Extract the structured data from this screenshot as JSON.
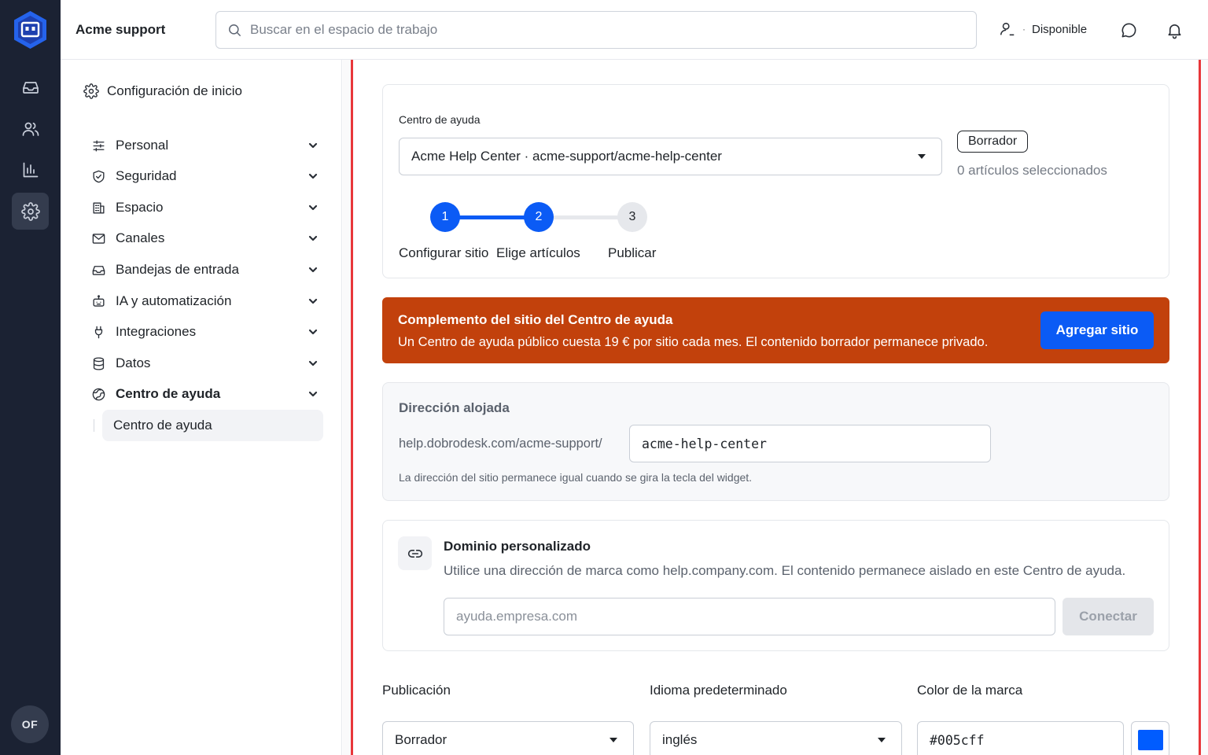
{
  "app": {
    "workspace_name": "Acme support"
  },
  "search": {
    "placeholder": "Buscar en el espacio de trabajo"
  },
  "status": {
    "label": "Disponible"
  },
  "user": {
    "initials": "OF"
  },
  "rail": {
    "items": [
      "inbox-icon",
      "users-icon",
      "chart-icon",
      "gear-icon"
    ],
    "active": "gear-icon"
  },
  "sidebar": {
    "title": "Configuración de inicio",
    "items": [
      {
        "label": "Personal",
        "icon": "sliders-icon"
      },
      {
        "label": "Seguridad",
        "icon": "shield-icon"
      },
      {
        "label": "Espacio",
        "icon": "building-icon"
      },
      {
        "label": "Canales",
        "icon": "mail-icon"
      },
      {
        "label": "Bandejas de entrada",
        "icon": "inbox-icon"
      },
      {
        "label": "IA y automatización",
        "icon": "robot-icon"
      },
      {
        "label": "Integraciones",
        "icon": "plug-icon"
      },
      {
        "label": "Datos",
        "icon": "database-icon"
      },
      {
        "label": "Centro de ayuda",
        "icon": "globe-icon",
        "expanded": true
      }
    ],
    "sub_item": "Centro de ayuda"
  },
  "help_center": {
    "label": "Centro de ayuda",
    "selected": "Acme Help Center · acme-support/acme-help-center",
    "badge": "Borrador",
    "articles_count": "0 artículos seleccionados",
    "steps": [
      {
        "number": "1",
        "label": "Configurar sitio",
        "state": "done"
      },
      {
        "number": "2",
        "label": "Elige artículos",
        "state": "done"
      },
      {
        "number": "3",
        "label": "Publicar",
        "state": "todo"
      }
    ]
  },
  "banner": {
    "title": "Complemento del sitio del Centro de ayuda",
    "text": "Un Centro de ayuda público cuesta 19 € por sitio cada mes. El contenido borrador permanece privado.",
    "button": "Agregar sitio",
    "color": "#c2410c"
  },
  "hosted": {
    "title": "Dirección alojada",
    "prefix": "help.dobrodesk.com/acme-support/",
    "slug": "acme-help-center",
    "hint": "La dirección del sitio permanece igual cuando se gira la tecla del widget."
  },
  "custom_domain": {
    "title": "Dominio personalizado",
    "description": "Utilice una dirección de marca como help.company.com. El contenido permanece aislado en este Centro de ayuda.",
    "placeholder": "ayuda.empresa.com",
    "button": "Conectar"
  },
  "settings": {
    "publication_label": "Publicación",
    "publication_value": "Borrador",
    "language_label": "Idioma predeterminado",
    "language_value": "inglés",
    "brand_label": "Color de la marca",
    "brand_value": "#005cff"
  },
  "colors": {
    "accent": "#0b5bf5",
    "focus": "#e8373a",
    "rail": "#1b2233"
  }
}
